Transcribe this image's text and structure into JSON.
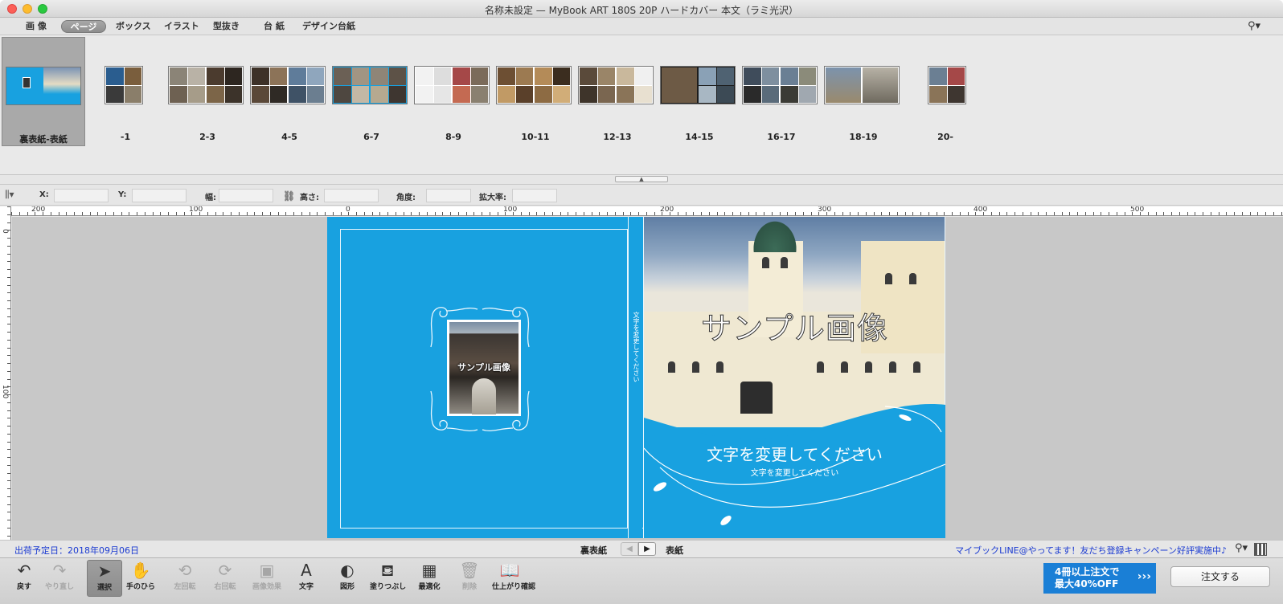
{
  "window": {
    "title": "名称未設定 — MyBook ART 180S 20P ハードカバー 本文（ラミ光沢）"
  },
  "tabs": [
    {
      "label": "画 像",
      "active": false
    },
    {
      "label": "ページ",
      "active": true
    },
    {
      "label": "ボックス",
      "active": false
    },
    {
      "label": "イラスト",
      "active": false
    },
    {
      "label": "型抜き",
      "active": false
    },
    {
      "label": "台 紙",
      "active": false
    },
    {
      "label": "デザイン台紙",
      "active": false
    }
  ],
  "pages": [
    {
      "label": "裏表紙-表紙",
      "selected": true
    },
    {
      "label": "-1"
    },
    {
      "label": "2-3"
    },
    {
      "label": "4-5"
    },
    {
      "label": "6-7"
    },
    {
      "label": "8-9"
    },
    {
      "label": "10-11"
    },
    {
      "label": "12-13"
    },
    {
      "label": "14-15"
    },
    {
      "label": "16-17"
    },
    {
      "label": "18-19"
    },
    {
      "label": "20-"
    }
  ],
  "coords": {
    "x_label": "X:",
    "y_label": "Y:",
    "width_label": "幅:",
    "height_label": "高さ:",
    "angle_label": "角度:",
    "zoom_label": "拡大率:"
  },
  "ruler": {
    "h_ticks": [
      "200",
      "100",
      "0",
      "100",
      "200",
      "300",
      "400",
      "500"
    ],
    "v_ticks": [
      "0",
      "100"
    ]
  },
  "canvas": {
    "back_photo_text": "サンプル画像",
    "front_photo_text": "サンプル画像",
    "spine_text": "文字を変更してください",
    "front_title": "文字を変更してください",
    "front_subtitle": "文字を変更してください"
  },
  "status": {
    "ship_date": "出荷予定日：2018年09月06日",
    "page_back": "裏表紙",
    "page_front": "表紙",
    "promo_link": "マイブックLINE@やってます！友だち登録キャンペーン好評実施中♪"
  },
  "tools": [
    {
      "label": "戻す",
      "icon": "undo-icon",
      "glyph": "↶",
      "enabled": true
    },
    {
      "label": "やり直し",
      "icon": "redo-icon",
      "glyph": "↷",
      "enabled": false
    },
    {
      "label": "選択",
      "icon": "pointer-icon",
      "glyph": "➤",
      "enabled": true,
      "active": true
    },
    {
      "label": "手のひら",
      "icon": "hand-icon",
      "glyph": "✋",
      "enabled": true
    },
    {
      "label": "左回転",
      "icon": "rotate-left-icon",
      "glyph": "⟲",
      "enabled": false
    },
    {
      "label": "右回転",
      "icon": "rotate-right-icon",
      "glyph": "⟳",
      "enabled": false
    },
    {
      "label": "画像効果",
      "icon": "image-effect-icon",
      "glyph": "▣",
      "enabled": false
    },
    {
      "label": "文字",
      "icon": "text-icon",
      "glyph": "A",
      "enabled": true
    },
    {
      "label": "図形",
      "icon": "shape-icon",
      "glyph": "◐",
      "enabled": true
    },
    {
      "label": "塗りつぶし",
      "icon": "paint-bucket-icon",
      "glyph": "⛾",
      "enabled": true
    },
    {
      "label": "最適化",
      "icon": "optimize-icon",
      "glyph": "▦",
      "enabled": true
    },
    {
      "label": "削除",
      "icon": "trash-icon",
      "glyph": "🗑",
      "enabled": false
    },
    {
      "label": "仕上がり確認",
      "icon": "book-preview-icon",
      "glyph": "📖",
      "enabled": true
    }
  ],
  "promo_banner": {
    "line1": "4冊以上注文で",
    "line2": "最大40%OFF"
  },
  "order_button": "注文する",
  "colors": {
    "cover_blue": "#18a1e0",
    "link_blue": "#1a3ad1",
    "promo_blue": "#1a7fd6"
  }
}
